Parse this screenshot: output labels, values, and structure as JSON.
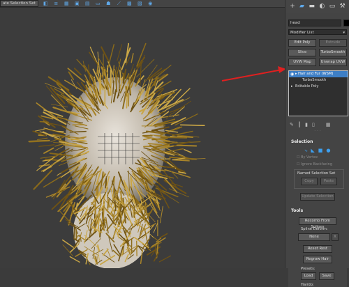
{
  "toolbar": {
    "selection_set": "ate Selection Set",
    "icons": [
      "selection-set-icon",
      "layer-icon",
      "scene-explorer-icon",
      "material-editor-icon",
      "render-setup-icon",
      "render-frame-icon",
      "render-icon",
      "curve-editor-icon",
      "schematic-icon",
      "wrench-icon",
      "teapot-icon"
    ]
  },
  "command_panel": {
    "tabs": [
      "+",
      "modify",
      "hierarchy",
      "motion",
      "display",
      "utilities"
    ],
    "object_name": "head",
    "object_color": "#000000",
    "modifier_list_label": "Modifier List",
    "modifier_buttons": [
      {
        "label": "Edit Poly",
        "enabled": true
      },
      {
        "label": "Extrude",
        "enabled": false
      },
      {
        "label": "Slice",
        "enabled": true
      },
      {
        "label": "TurboSmooth",
        "enabled": true
      },
      {
        "label": "UVW Map",
        "enabled": true
      },
      {
        "label": "Unwrap UVW",
        "enabled": true
      }
    ],
    "stack": [
      {
        "label": "Hair and Fur (WSM)",
        "selected": true
      },
      {
        "label": "TurboSmooth",
        "selected": false
      },
      {
        "label": "Editable Poly",
        "selected": false
      }
    ]
  },
  "selection_rollout": {
    "title": "Selection",
    "by_vertex": "By Vertex",
    "ignore_backfacing": "Ignore Backfacing",
    "named_selection_set": "Named Selection Set",
    "copy": "Copy",
    "paste": "Paste",
    "update_selection": "Update Selection"
  },
  "tools_rollout": {
    "title": "Tools",
    "recomb_from_splines": "Recomb From Splines",
    "spline_deform": "Spline Deform:",
    "none": "None",
    "x": "X",
    "reset_rest": "Reset Rest",
    "regrow_hair": "Regrow Hair",
    "presets": "Presets:",
    "load": "Load",
    "save": "Save",
    "hairdo": "Hairdo:"
  },
  "colors": {
    "accent": "#3e7fc6",
    "hair": "#8a6a1a",
    "annotation_arrow": "#e02020"
  }
}
